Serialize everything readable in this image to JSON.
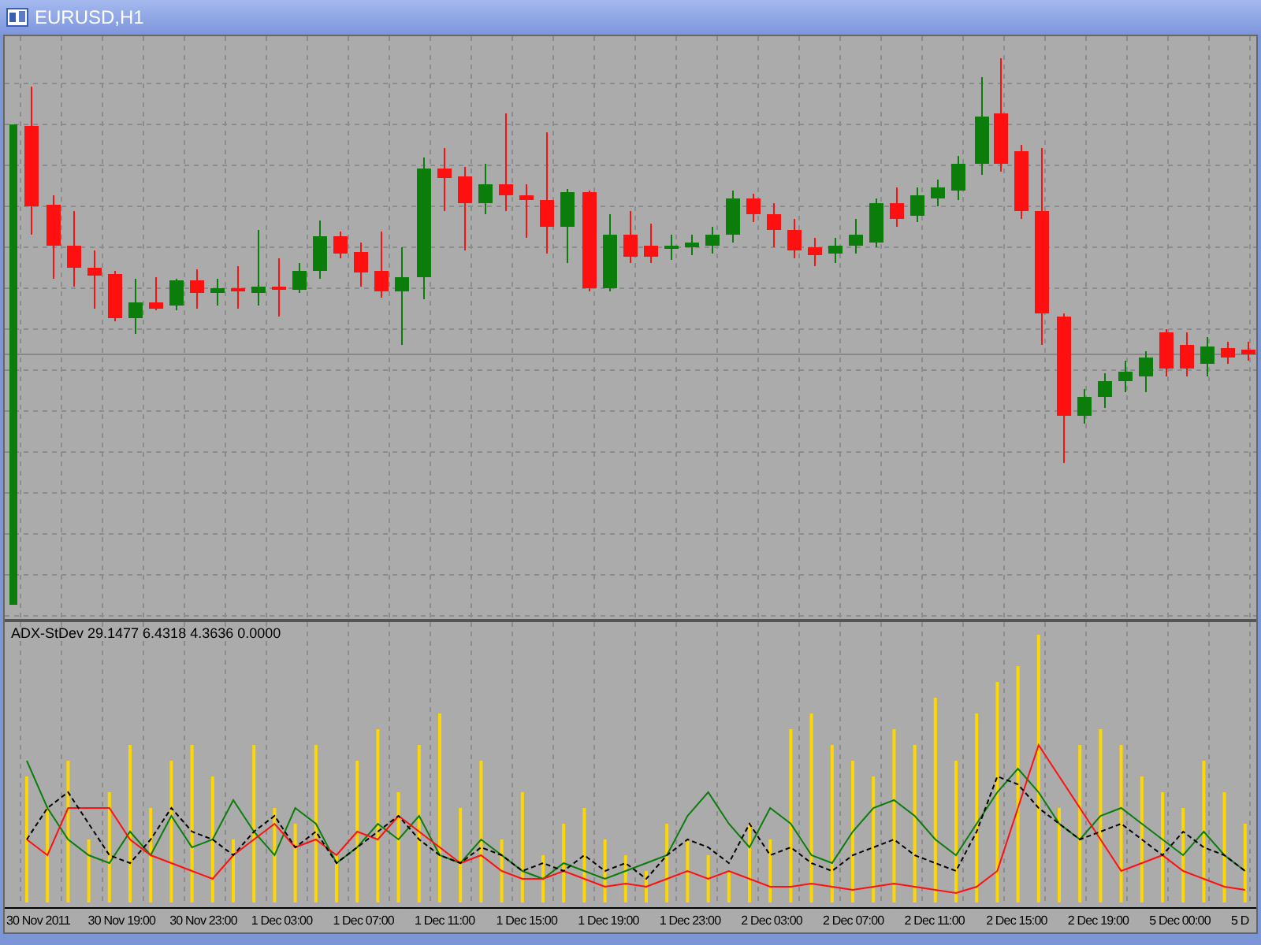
{
  "window": {
    "title": "EURUSD,H1"
  },
  "indicator": {
    "label": "ADX-StDev 29.1477 6.4318 4.3636 0.0000"
  },
  "time_axis": {
    "labels": [
      "30 Nov 2011",
      "30 Nov 19:00",
      "30 Nov 23:00",
      "1 Dec 03:00",
      "1 Dec 07:00",
      "1 Dec 11:00",
      "1 Dec 15:00",
      "1 Dec 19:00",
      "1 Dec 23:00",
      "2 Dec 03:00",
      "2 Dec 07:00",
      "2 Dec 11:00",
      "2 Dec 15:00",
      "2 Dec 19:00",
      "5 Dec 00:00",
      "5 D"
    ]
  }
}
